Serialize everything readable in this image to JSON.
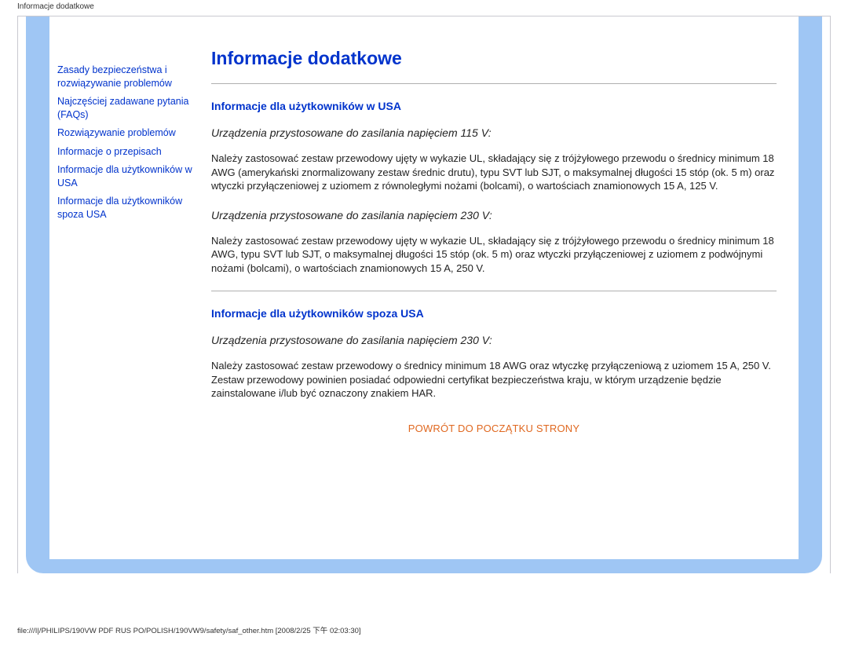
{
  "page_label": "Informacje dodatkowe",
  "sidebar": {
    "links": [
      "Zasady bezpieczeństwa i rozwiązywanie problemów",
      "Najczęściej  zadawane pytania (FAQs)",
      "Rozwiązywanie problemów",
      "Informacje o przepisach",
      "Informacje dla użytkowników w USA",
      "Informacje dla użytkowników spoza USA"
    ]
  },
  "main": {
    "title": "Informacje dodatkowe",
    "section1": {
      "heading": "Informacje dla użytkowników w USA",
      "sub1": "Urządzenia przystosowane do zasilania napięciem 115 V:",
      "p1": "Należy zastosować zestaw przewodowy ujęty w wykazie UL, składający się z trójżyłowego przewodu o średnicy minimum 18 AWG (amerykański znormalizowany zestaw średnic drutu), typu SVT lub SJT, o maksymalnej długości 15 stóp (ok. 5 m) oraz wtyczki przyłączeniowej z uziomem z równoległymi nożami (bolcami), o wartościach znamionowych 15 A, 125 V.",
      "sub2": "Urządzenia przystosowane do zasilania napięciem 230 V:",
      "p2": "Należy zastosować zestaw przewodowy ujęty w wykazie UL, składający się z trójżyłowego przewodu o średnicy minimum 18 AWG, typu SVT lub SJT, o maksymalnej długości 15 stóp (ok. 5 m) oraz wtyczki przyłączeniowej z uziomem z podwójnymi nożami (bolcami), o wartościach znamionowych 15 A, 250 V."
    },
    "section2": {
      "heading": "Informacje dla użytkowników spoza USA",
      "sub1": "Urządzenia przystosowane do zasilania napięciem 230 V:",
      "p1": "Należy zastosować zestaw przewodowy o średnicy minimum 18 AWG oraz wtyczkę przyłączeniową z uziomem 15 A, 250 V. Zestaw przewodowy powinien posiadać odpowiedni certyfikat bezpieczeństwa kraju, w którym urządzenie będzie zainstalowane i/lub być oznaczony znakiem HAR."
    },
    "back": "POWRÓT DO POCZĄTKU STRONY"
  },
  "footer": "file:///I|/PHILIPS/190VW PDF RUS PO/POLISH/190VW9/safety/saf_other.htm [2008/2/25 下午 02:03:30]"
}
